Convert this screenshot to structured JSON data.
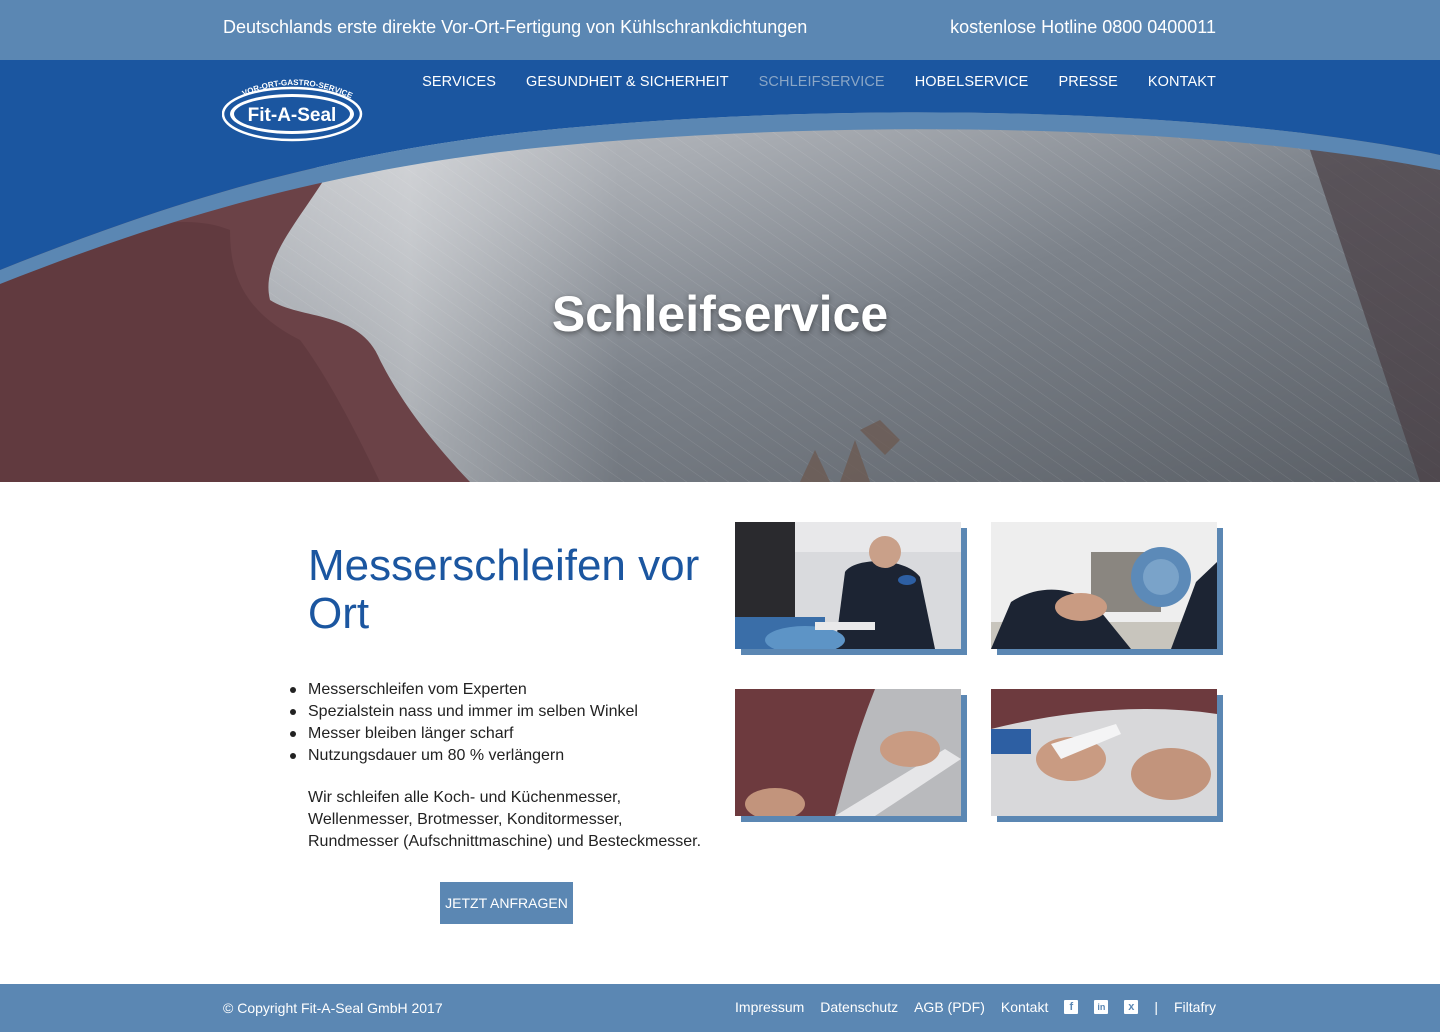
{
  "topbar": {
    "tagline": "Deutschlands erste direkte Vor-Ort-Fertigung von Kühlschrankdichtungen",
    "hotline": "kostenlose Hotline 0800 0400011"
  },
  "logo": {
    "arc_text": "VOR-ORT-GASTRO-SERVICE",
    "name": "Fit-A-Seal"
  },
  "nav": {
    "items": [
      {
        "label": "SERVICES"
      },
      {
        "label": "GESUNDHEIT & SICHERHEIT"
      },
      {
        "label": "SCHLEIFSERVICE"
      },
      {
        "label": "HOBELSERVICE"
      },
      {
        "label": "PRESSE"
      },
      {
        "label": "KONTAKT"
      }
    ],
    "active_index": 2
  },
  "hero": {
    "title": "Schleifservice"
  },
  "main": {
    "title": "Messerschleifen vor Ort",
    "bullets": [
      "Messerschleifen vom Experten",
      "Spezialstein nass und immer im selben Winkel",
      "Messer bleiben länger scharf",
      "Nutzungsdauer um 80 % verlängern"
    ],
    "description": "Wir schleifen alle Koch- und Küchenmesser, Wellenmesser, Brotmesser, Konditormesser, Rundmesser (Aufschnittmaschine) und Besteckmesser.",
    "cta_label": "JETZT ANFRAGEN"
  },
  "footer": {
    "copyright": "© Copyright Fit-A-Seal GmbH 2017",
    "links": [
      "Impressum",
      "Datenschutz",
      "AGB (PDF)",
      "Kontakt"
    ],
    "social_icons": [
      "facebook-icon",
      "linkedin-icon",
      "xing-icon"
    ],
    "separator": "|",
    "credit": "Filtafry"
  },
  "colors": {
    "brand_blue": "#1b56a0",
    "light_blue": "#5b87b3",
    "nav_active": "#8aa6c6"
  }
}
